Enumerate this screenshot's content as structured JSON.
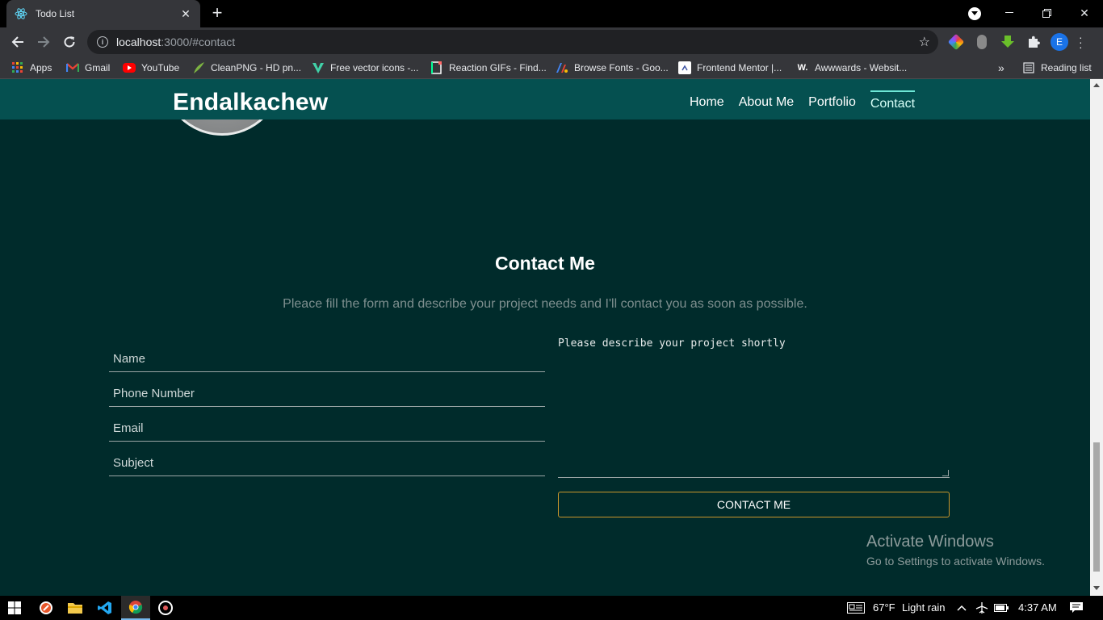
{
  "browser": {
    "tab_title": "Todo List",
    "url_host": "localhost",
    "url_path": ":3000/#contact",
    "bookmarks": [
      {
        "label": "Apps",
        "icon": "apps-grid-icon",
        "color": "#ea4335"
      },
      {
        "label": "Gmail",
        "icon": "gmail-icon",
        "color": "#ea4335"
      },
      {
        "label": "YouTube",
        "icon": "youtube-icon",
        "color": "#ff0000"
      },
      {
        "label": "CleanPNG - HD pn...",
        "icon": "cleanpng-icon",
        "color": "#7cb342"
      },
      {
        "label": "Free vector icons -...",
        "icon": "vector-icon",
        "color": "#41d1a8"
      },
      {
        "label": "Reaction GIFs - Find...",
        "icon": "gif-icon",
        "color": "#ffffff"
      },
      {
        "label": "Browse Fonts - Goo...",
        "icon": "fonts-icon",
        "color": "#4285f4"
      },
      {
        "label": "Frontend Mentor |...",
        "icon": "frontend-mentor-icon",
        "color": "#ffffff"
      },
      {
        "label": "Awwwards - Websit...",
        "icon": "awwwards-icon",
        "color": "#222222"
      }
    ],
    "more_bookmarks": "»",
    "reading_list": "Reading list",
    "avatar_letter": "E"
  },
  "site": {
    "brand": "Endalkachew",
    "nav": [
      {
        "label": "Home",
        "active": false
      },
      {
        "label": "About Me",
        "active": false
      },
      {
        "label": "Portfolio",
        "active": false
      },
      {
        "label": "Contact",
        "active": true
      }
    ],
    "contact": {
      "title": "Contact Me",
      "subtitle": "Pleace fill the form and describe your project needs and I'll contact you as soon as possible.",
      "fields": [
        {
          "placeholder": "Name"
        },
        {
          "placeholder": "Phone Number"
        },
        {
          "placeholder": "Email"
        },
        {
          "placeholder": "Subject"
        }
      ],
      "textarea_placeholder": "Please describe your project shortly",
      "button": "CONTACT ME"
    }
  },
  "watermark": {
    "line1": "Activate Windows",
    "line2": "Go to Settings to activate Windows."
  },
  "taskbar": {
    "weather": "67°F",
    "weather_desc": "Light rain",
    "time": "4:37 AM"
  },
  "colors": {
    "page_bg": "#002b2b",
    "navbar_bg": "#055050",
    "button_border": "#c9962c",
    "active_underline": "#6ee7d6"
  }
}
